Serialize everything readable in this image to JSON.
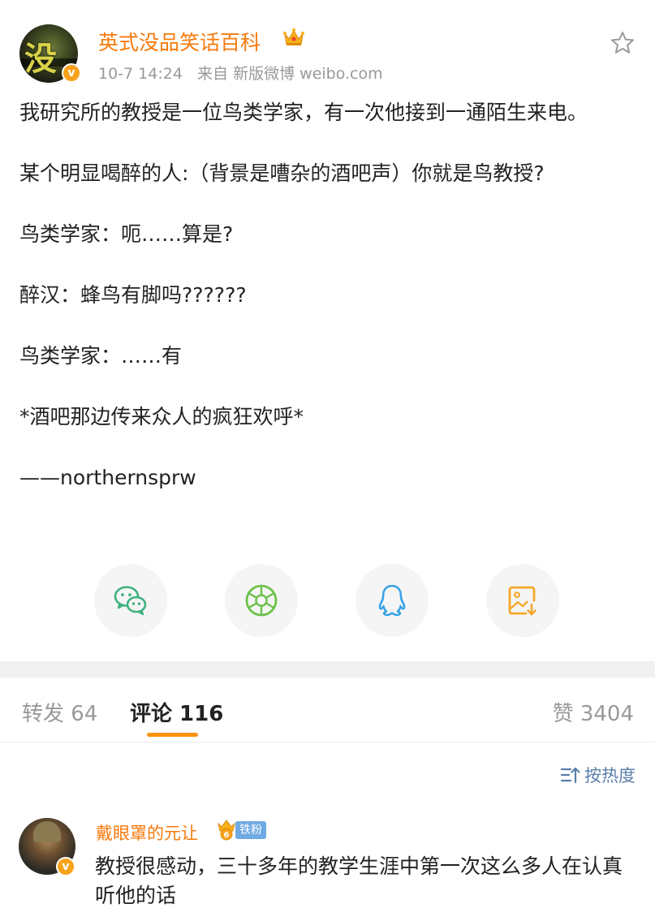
{
  "post": {
    "author": "英式没品笑话百科",
    "avatar_glyph": "没",
    "time": "10-7 14:24",
    "source_prefix": "来自",
    "source": "新版微博 weibo.com",
    "verified_mark": "v",
    "paragraphs": [
      "我研究所的教授是一位鸟类学家，有一次他接到一通陌生来电。",
      "某个明显喝醉的人:（背景是嘈杂的酒吧声）你就是鸟教授?",
      "鸟类学家：呃……算是?",
      "醉汉：蜂鸟有脚吗??????",
      "鸟类学家：……有",
      "*酒吧那边传来众人的疯狂欢呼*",
      "——northernsprw"
    ]
  },
  "share": {
    "icons": [
      "wechat-icon",
      "moments-icon",
      "qq-icon",
      "save-image-icon"
    ]
  },
  "tabs": {
    "repost": "转发 64",
    "comments": "评论 116",
    "likes": "赞 3404"
  },
  "sort": {
    "label": "按热度"
  },
  "comment": {
    "author": "戴眼罩的元让",
    "fan_badge": "铁粉",
    "medal_text": "6",
    "verified_mark": "v",
    "text": "教授很感动，三十多年的教学生涯中第一次这么多人在认真听他的话"
  },
  "colors": {
    "accent": "#f77a0c",
    "tab_underline": "#f7930e",
    "link_blue": "#5a7ea9",
    "wechat_green": "#3fb27f",
    "moments_green": "#6cc24a",
    "qq_blue": "#3aa3e8",
    "save_orange": "#f4a72b"
  }
}
